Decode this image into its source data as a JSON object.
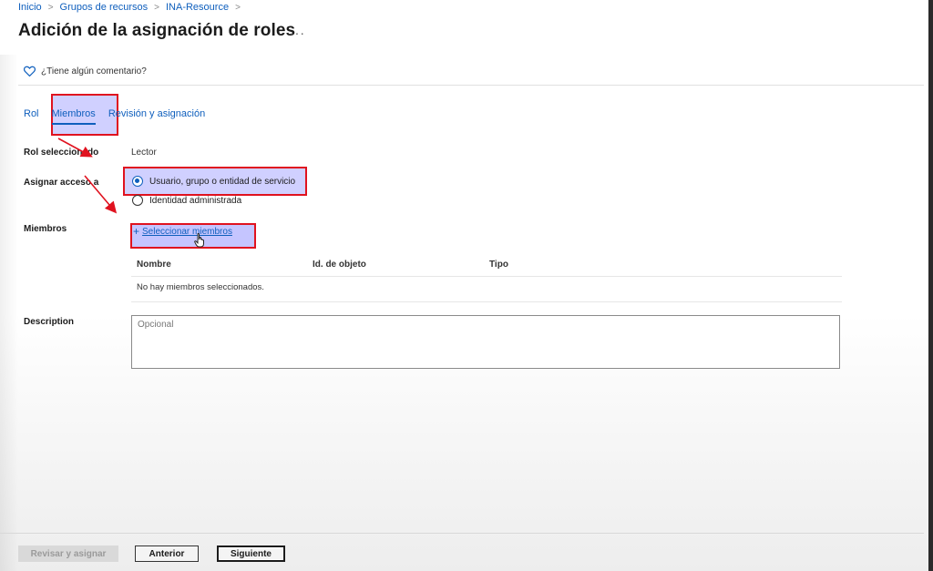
{
  "breadcrumb": {
    "items": [
      "Inicio",
      "Grupos de recursos",
      "INA-Resource"
    ],
    "separator": ">"
  },
  "page": {
    "title": "Adición de la asignación de roles",
    "more": "···"
  },
  "feedback": {
    "label": "¿Tiene algún comentario?",
    "icon": "heart-icon"
  },
  "tabs": [
    {
      "label": "Rol",
      "active": false
    },
    {
      "label": "Miembros",
      "active": true
    },
    {
      "label": "Revisión y asignación",
      "active": false
    }
  ],
  "form": {
    "selected_role_label": "Rol seleccionado",
    "selected_role_value": "Lector",
    "assign_access_label": "Asignar acceso a",
    "assign_options": [
      {
        "label": "Usuario, grupo o entidad de servicio",
        "checked": true
      },
      {
        "label": "Identidad administrada",
        "checked": false
      }
    ],
    "members_label": "Miembros",
    "select_members_label": "Seleccionar miembros",
    "table": {
      "columns": [
        "Nombre",
        "Id. de objeto",
        "Tipo"
      ],
      "empty_message": "No hay miembros seleccionados."
    },
    "description_label": "Description",
    "description_placeholder": "Opcional"
  },
  "footer": {
    "review_assign": "Revisar y asignar",
    "previous": "Anterior",
    "next": "Siguiente"
  },
  "colors": {
    "link": "#0f5fbd",
    "highlight_border": "#e0121f",
    "highlight_fill": "#9696ff"
  }
}
